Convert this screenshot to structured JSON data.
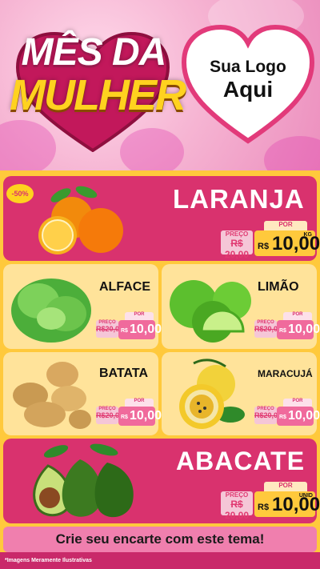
{
  "header": {
    "title_line1": "MÊS DA",
    "title_line2": "MULHER",
    "logo_line1": "Sua Logo",
    "logo_line2": "Aqui"
  },
  "badge": "-50%",
  "products": [
    {
      "name": "LARANJA",
      "preco_label": "PREÇO",
      "old_price": "R$ 20,00",
      "por_label": "POR",
      "currency": "R$",
      "new_price": "10,00",
      "unit": "KG"
    },
    {
      "name": "ALFACE",
      "preco_label": "PREÇO",
      "old_price": "R$20,00",
      "por_label": "POR",
      "currency": "R$",
      "new_price": "10,00"
    },
    {
      "name": "LIMÃO",
      "preco_label": "PREÇO",
      "old_price": "R$20,00",
      "por_label": "POR",
      "currency": "R$",
      "new_price": "10,00"
    },
    {
      "name": "BATATA",
      "preco_label": "PREÇO",
      "old_price": "R$20,00",
      "por_label": "POR",
      "currency": "R$",
      "new_price": "10,00"
    },
    {
      "name": "MARACUJÁ",
      "preco_label": "PREÇO",
      "old_price": "R$20,00",
      "por_label": "POR",
      "currency": "R$",
      "new_price": "10,00"
    },
    {
      "name": "ABACATE",
      "preco_label": "PREÇO",
      "old_price": "R$ 20,00",
      "por_label": "POR",
      "currency": "R$",
      "new_price": "10,00",
      "unit": "UNID"
    }
  ],
  "cta": "Crie seu encarte com este tema!",
  "footer_note": "*Imagens Meramente Ilustrativas",
  "colors": {
    "pink": "#d9326e",
    "yellow": "#ffc93c",
    "cream": "#ffe39a",
    "cta": "#f07fae"
  }
}
